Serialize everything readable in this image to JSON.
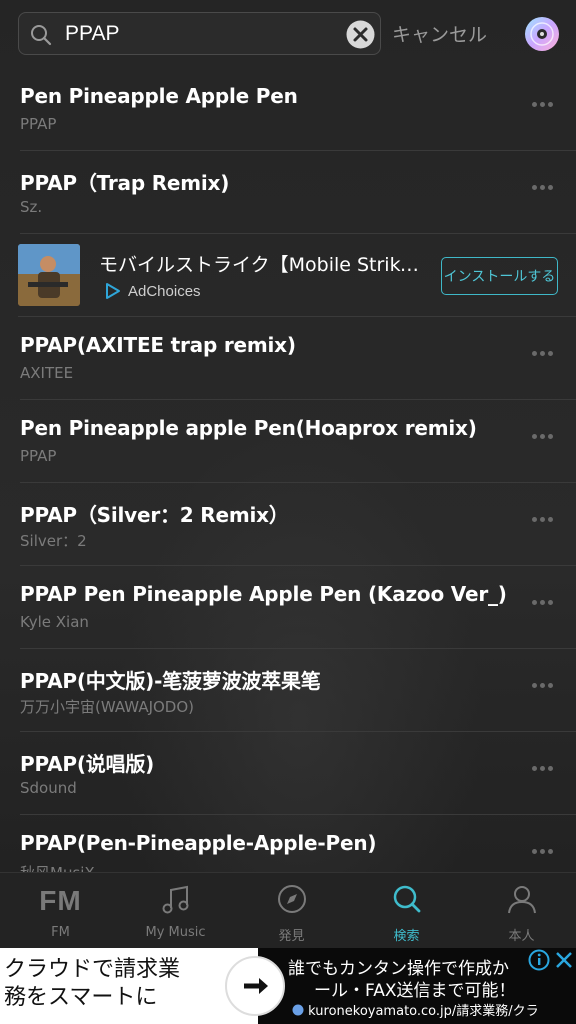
{
  "search": {
    "query": "PPAP",
    "cancel_label": "キャンセル"
  },
  "results": [
    {
      "title": "Pen Pineapple Apple Pen",
      "artist": "PPAP"
    },
    {
      "title": "PPAP（Trap Remix)",
      "artist": "Sz."
    },
    {
      "title": "PPAP(AXITEE trap remix)",
      "artist": "AXITEE"
    },
    {
      "title": "Pen Pineapple apple Pen(Hoaprox remix)",
      "artist": "PPAP"
    },
    {
      "title": "PPAP（Silver：2 Remix）",
      "artist": "Silver：2"
    },
    {
      "title": "PPAP Pen Pineapple Apple Pen (Kazoo Ver_)",
      "artist": "Kyle Xian"
    },
    {
      "title": "PPAP(中文版)-笔菠萝波波萃果笔",
      "artist": "万万小宇宙(WAWAJODO)"
    },
    {
      "title": "PPAP(说唱版)",
      "artist": "Sdound"
    },
    {
      "title": "PPAP(Pen-Pineapple-Apple-Pen)",
      "artist": "秋风MusiX"
    }
  ],
  "inline_ad": {
    "title": "モバイルストライク【Mobile Strike】",
    "adchoices_label": "AdChoices",
    "install_label": "インストールする"
  },
  "tabs": [
    {
      "label": "FM",
      "icon": "fm-icon",
      "active": false
    },
    {
      "label": "My Music",
      "icon": "music-note-icon",
      "active": false
    },
    {
      "label": "発見",
      "icon": "compass-icon",
      "active": false
    },
    {
      "label": "検索",
      "icon": "search-icon",
      "active": true
    },
    {
      "label": "本人",
      "icon": "person-icon",
      "active": false
    }
  ],
  "tab_fm_glyph": "FM",
  "bottom_ad": {
    "left_text_1": "クラウドで請求業",
    "left_text_2": "務をスマートに",
    "right_text_1": "誰でもカンタン操作で作成か",
    "right_text_2": "ール・FAX送信まで可能！",
    "url": "kuronekoyamato.co.jp/請求業務/クラ"
  },
  "colors": {
    "accent": "#3fbccc",
    "background": "#262626",
    "muted_text": "#7b7b7b"
  }
}
